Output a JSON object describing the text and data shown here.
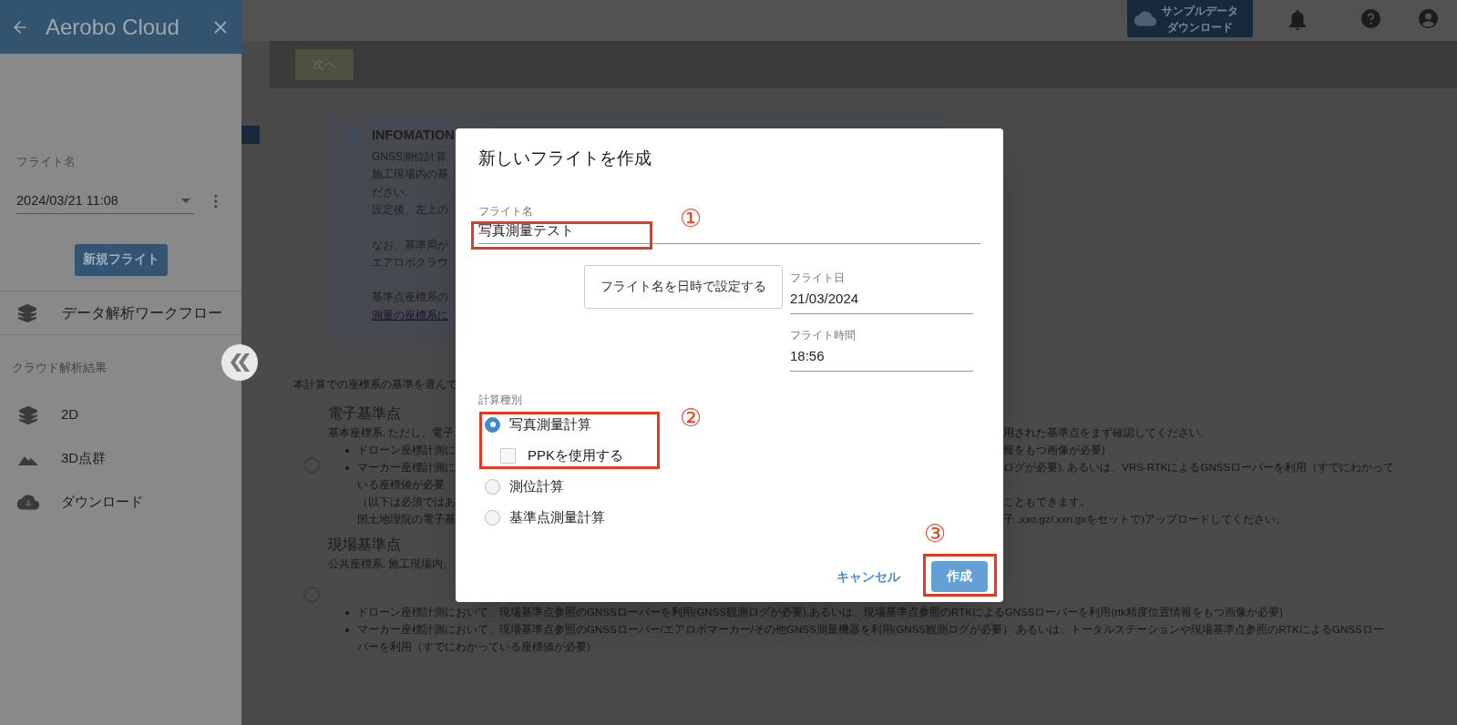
{
  "sidebar": {
    "title": "Aerobo Cloud",
    "flight_label": "フライト名",
    "flight_value": "2024/03/21 11:08",
    "new_flight_button": "新規フライト",
    "workflow_item": "データ解析ワークフロー",
    "results_header": "クラウド解析結果",
    "result_items": [
      {
        "label": "2D",
        "kind": "layers"
      },
      {
        "label": "3D点群",
        "kind": "terrain"
      },
      {
        "label": "ダウンロード",
        "kind": "download"
      }
    ]
  },
  "top_bar": {
    "sample_button": [
      "サンプルデータ",
      "ダウンロード"
    ]
  },
  "toolbar": {
    "next_button": "次へ"
  },
  "info_box": {
    "title": "INFOMATION",
    "paragraphs": [
      [
        "GNSS測位計算",
        "施工現場内の基",
        "ださい.",
        "設定後、左上の"
      ],
      [
        "なお、基準局が",
        "エアロボクラウ"
      ],
      [
        "基準点座標系の"
      ]
    ],
    "link": "測量の座標系に"
  },
  "reference_section": {
    "intro": "本計算での座標系の基準を選んで",
    "options": [
      {
        "title": "電子基準点",
        "selected": false,
        "lines": [
          {
            "kind": "text",
            "left": "基本座標系. ただし、電子",
            "right": "用された基準点をまず確認してください."
          },
          {
            "kind": "bullet",
            "left": "ドローン座標計測に",
            "right": "報をもつ画像が必要)"
          },
          {
            "kind": "bullet",
            "left": "マーカー座標計測に",
            "right": "ログが必要). あるいは、VRS-RTKによるGNSSローバーを利用（すでにわかって"
          },
          {
            "kind": "continuation",
            "left": "いる座標値が必要"
          },
          {
            "kind": "continuation",
            "left": "（以下は必須ではあ",
            "right": "こともできます。"
          },
          {
            "kind": "continuation",
            "left": "国土地理院の電子基",
            "right": "子 .xxo.gz/.xxn.gxをセットで)アップロードしてください。"
          }
        ]
      },
      {
        "title": "現場基準点",
        "selected": false,
        "lines": [
          {
            "kind": "text",
            "left": "公共座標系. 施工現場内、"
          },
          {
            "kind": "full_bullet",
            "left": "ドローン座標計測において、現場基準点参照のGNSSローバーを利用(GNSS観測ログが必要).あるいは、現場基準点参照のRTKによるGNSSローバーを利用(rtk精度位置情報をもつ画像が必要)"
          },
          {
            "kind": "full_bullet",
            "left": "マーカー座標計測において、現場基準点参照のGNSSローバー/エアロボマーカー/その他GNSS測量機器を利用(GNSS観測ログが必要）.あるいは、トータルステーションや現場基準点参照のRTKによるGNSSロー"
          },
          {
            "kind": "full_continuation",
            "left": "バーを利用（すでにわかっている座標値が必要)"
          }
        ]
      }
    ]
  },
  "dialog": {
    "title": "新しいフライトを作成",
    "name_field": {
      "label": "フライト名",
      "value": "写真測量テスト"
    },
    "set_name_button": "フライト名を日時で設定する",
    "date_field": {
      "label": "フライト日",
      "value": "21/03/2024"
    },
    "time_field": {
      "label": "フライト時間",
      "value": "18:56"
    },
    "calc_type": {
      "label": "計算種別",
      "options": [
        {
          "label": "写真測量計算",
          "kind": "radio",
          "selected": true
        },
        {
          "label": "PPKを使用する",
          "kind": "checkbox",
          "checked": false
        },
        {
          "label": "測位計算",
          "kind": "radio",
          "selected": false
        },
        {
          "label": "基準点測量計算",
          "kind": "radio",
          "selected": false
        }
      ]
    },
    "cancel_button": "キャンセル",
    "create_button": "作成"
  },
  "annotations": [
    {
      "label": "①"
    },
    {
      "label": "②"
    },
    {
      "label": "③"
    }
  ]
}
